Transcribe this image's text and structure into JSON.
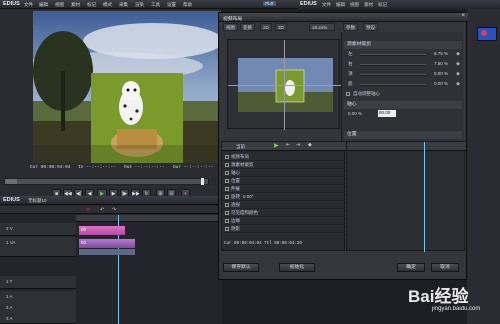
{
  "menubar": {
    "logo": "EDIUS",
    "items": [
      "文件",
      "编辑",
      "视图",
      "素材",
      "标记",
      "模式",
      "采集",
      "渲染",
      "工具",
      "设置",
      "帮助"
    ],
    "plr": "PLR"
  },
  "recbar": {
    "logo": "EDIUS",
    "items": [
      "文件",
      "编辑",
      "视图",
      "素材",
      "标记"
    ]
  },
  "player": {
    "tc_cur": "Cur 00:00:04:04",
    "tc_in": "In --:--:--:--",
    "tc_out": "Out --:--:--:--",
    "tc_dur": "Dur --:--:--:--",
    "tc_cur2": "Cur 00:00:04:04",
    "tc_in2": "In 00:00:00:00",
    "tc_out2": "Out 00:00:04:20",
    "tc_dur2": "Dur 00:00:04:21"
  },
  "dialog": {
    "title": "视频布局",
    "tabs": [
      "视图",
      "变换",
      "2D",
      "3D"
    ],
    "zoom": "18.24%",
    "right_tabs": [
      "参数",
      "预设"
    ],
    "crop_section": "源素材裁剪",
    "crop_rows": [
      {
        "label": "左",
        "value": "8.75 %"
      },
      {
        "label": "右",
        "value": "7.50 %"
      },
      {
        "label": "顶",
        "value": "0.00 %"
      },
      {
        "label": "底",
        "value": "0.00 %"
      }
    ],
    "auto_adjust": "自动调整轴心",
    "axis_section": "轴心",
    "axis_x": "0.00 %",
    "axis_y": "50.00",
    "pos_section": "位置",
    "tree_header": "当前",
    "tree_items": [
      "视频布局",
      "源素材裁剪",
      "轴心",
      "位置",
      "伸展",
      "旋转",
      "透视",
      "可见度和颜色",
      "边缘",
      "阴影"
    ],
    "tree_extra": [
      "0.00°"
    ],
    "footer_tc": "Cur 00:00:04:04  Ttl 00:00:04:20",
    "btn_save": "保存默认",
    "btn_init": "初始化",
    "btn_ok": "确定",
    "btn_cancel": "取消"
  },
  "timeline": {
    "logo": "EDIUS",
    "seq": "无标题10",
    "tracks": [
      "2 V",
      "1 VA",
      "1 T",
      "1 A",
      "2 A",
      "3 A",
      "4 A"
    ],
    "clip1": "00",
    "clip2": "00"
  },
  "watermark": {
    "text": "Bai经验",
    "url": "jingyan.baidu.com"
  }
}
